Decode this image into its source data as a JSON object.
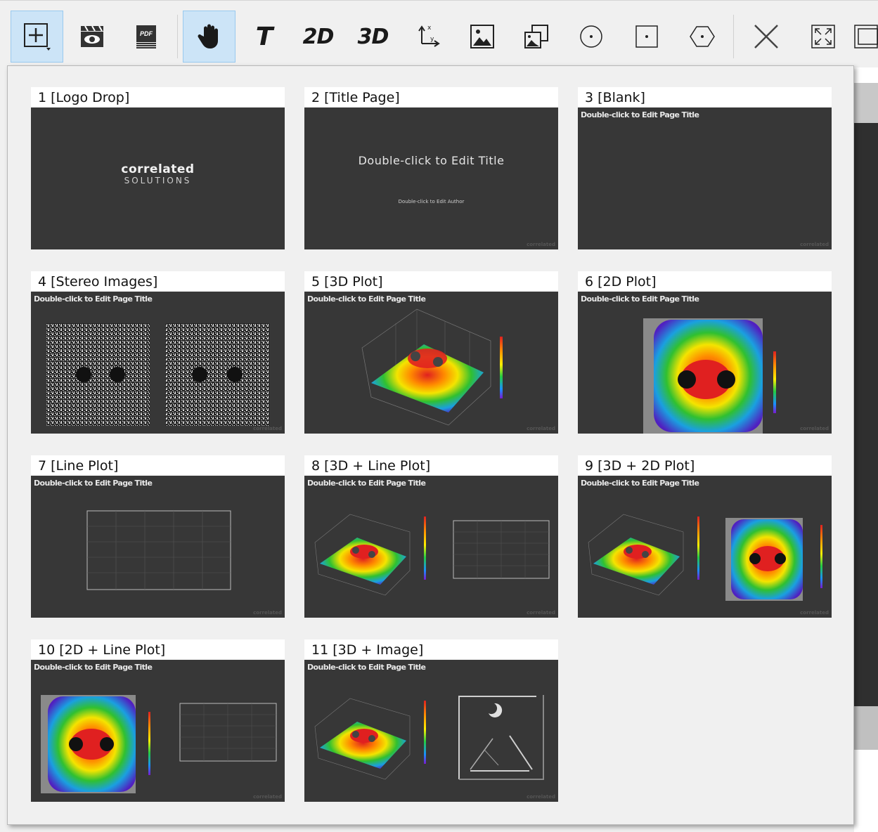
{
  "toolbar": {
    "buttons": [
      {
        "name": "add-page-button",
        "icon": "plus-square-icon",
        "active": true
      },
      {
        "name": "video-button",
        "icon": "clapperboard-eye-icon"
      },
      {
        "name": "pdf-button",
        "icon": "pdf-stack-icon"
      },
      {
        "name": "pan-button",
        "icon": "hand-icon",
        "active": true
      },
      {
        "name": "text-button",
        "icon": "text-t-icon",
        "label": "T"
      },
      {
        "name": "add-2d-button",
        "icon": "2d-icon",
        "label": "2D"
      },
      {
        "name": "add-3d-button",
        "icon": "3d-icon",
        "label": "3D"
      },
      {
        "name": "axes-button",
        "icon": "axes-icon"
      },
      {
        "name": "image-button",
        "icon": "image-icon"
      },
      {
        "name": "stereo-image-button",
        "icon": "image-stack-icon"
      },
      {
        "name": "circle-button",
        "icon": "circle-dot-icon"
      },
      {
        "name": "square-button",
        "icon": "square-dot-icon"
      },
      {
        "name": "hexagon-button",
        "icon": "hexagon-dot-icon"
      },
      {
        "name": "delete-button",
        "icon": "close-x-icon"
      },
      {
        "name": "fit-button",
        "icon": "expand-icon"
      },
      {
        "name": "extra-button",
        "icon": "partial-icon"
      }
    ]
  },
  "placeholder_title": "Double-click to Edit Page Title",
  "watermark": "correlated",
  "layouts": [
    {
      "label": "1 [Logo Drop]",
      "kind": "logo",
      "logo_main": "correlated",
      "logo_sub": "SOLUTIONS"
    },
    {
      "label": "2 [Title Page]",
      "kind": "title",
      "title": "Double-click to Edit Title",
      "author": "Double-click to Edit Author"
    },
    {
      "label": "3 [Blank]",
      "kind": "blank"
    },
    {
      "label": "4 [Stereo Images]",
      "kind": "stereo"
    },
    {
      "label": "5 [3D Plot]",
      "kind": "plot3d"
    },
    {
      "label": "6 [2D Plot]",
      "kind": "plot2d"
    },
    {
      "label": "7 [Line Plot]",
      "kind": "line"
    },
    {
      "label": "8 [3D + Line Plot]",
      "kind": "plot3d_line"
    },
    {
      "label": "9 [3D + 2D Plot]",
      "kind": "plot3d_2d"
    },
    {
      "label": "10 [2D + Line Plot]",
      "kind": "plot2d_line"
    },
    {
      "label": "11 [3D + Image]",
      "kind": "plot3d_image"
    }
  ]
}
